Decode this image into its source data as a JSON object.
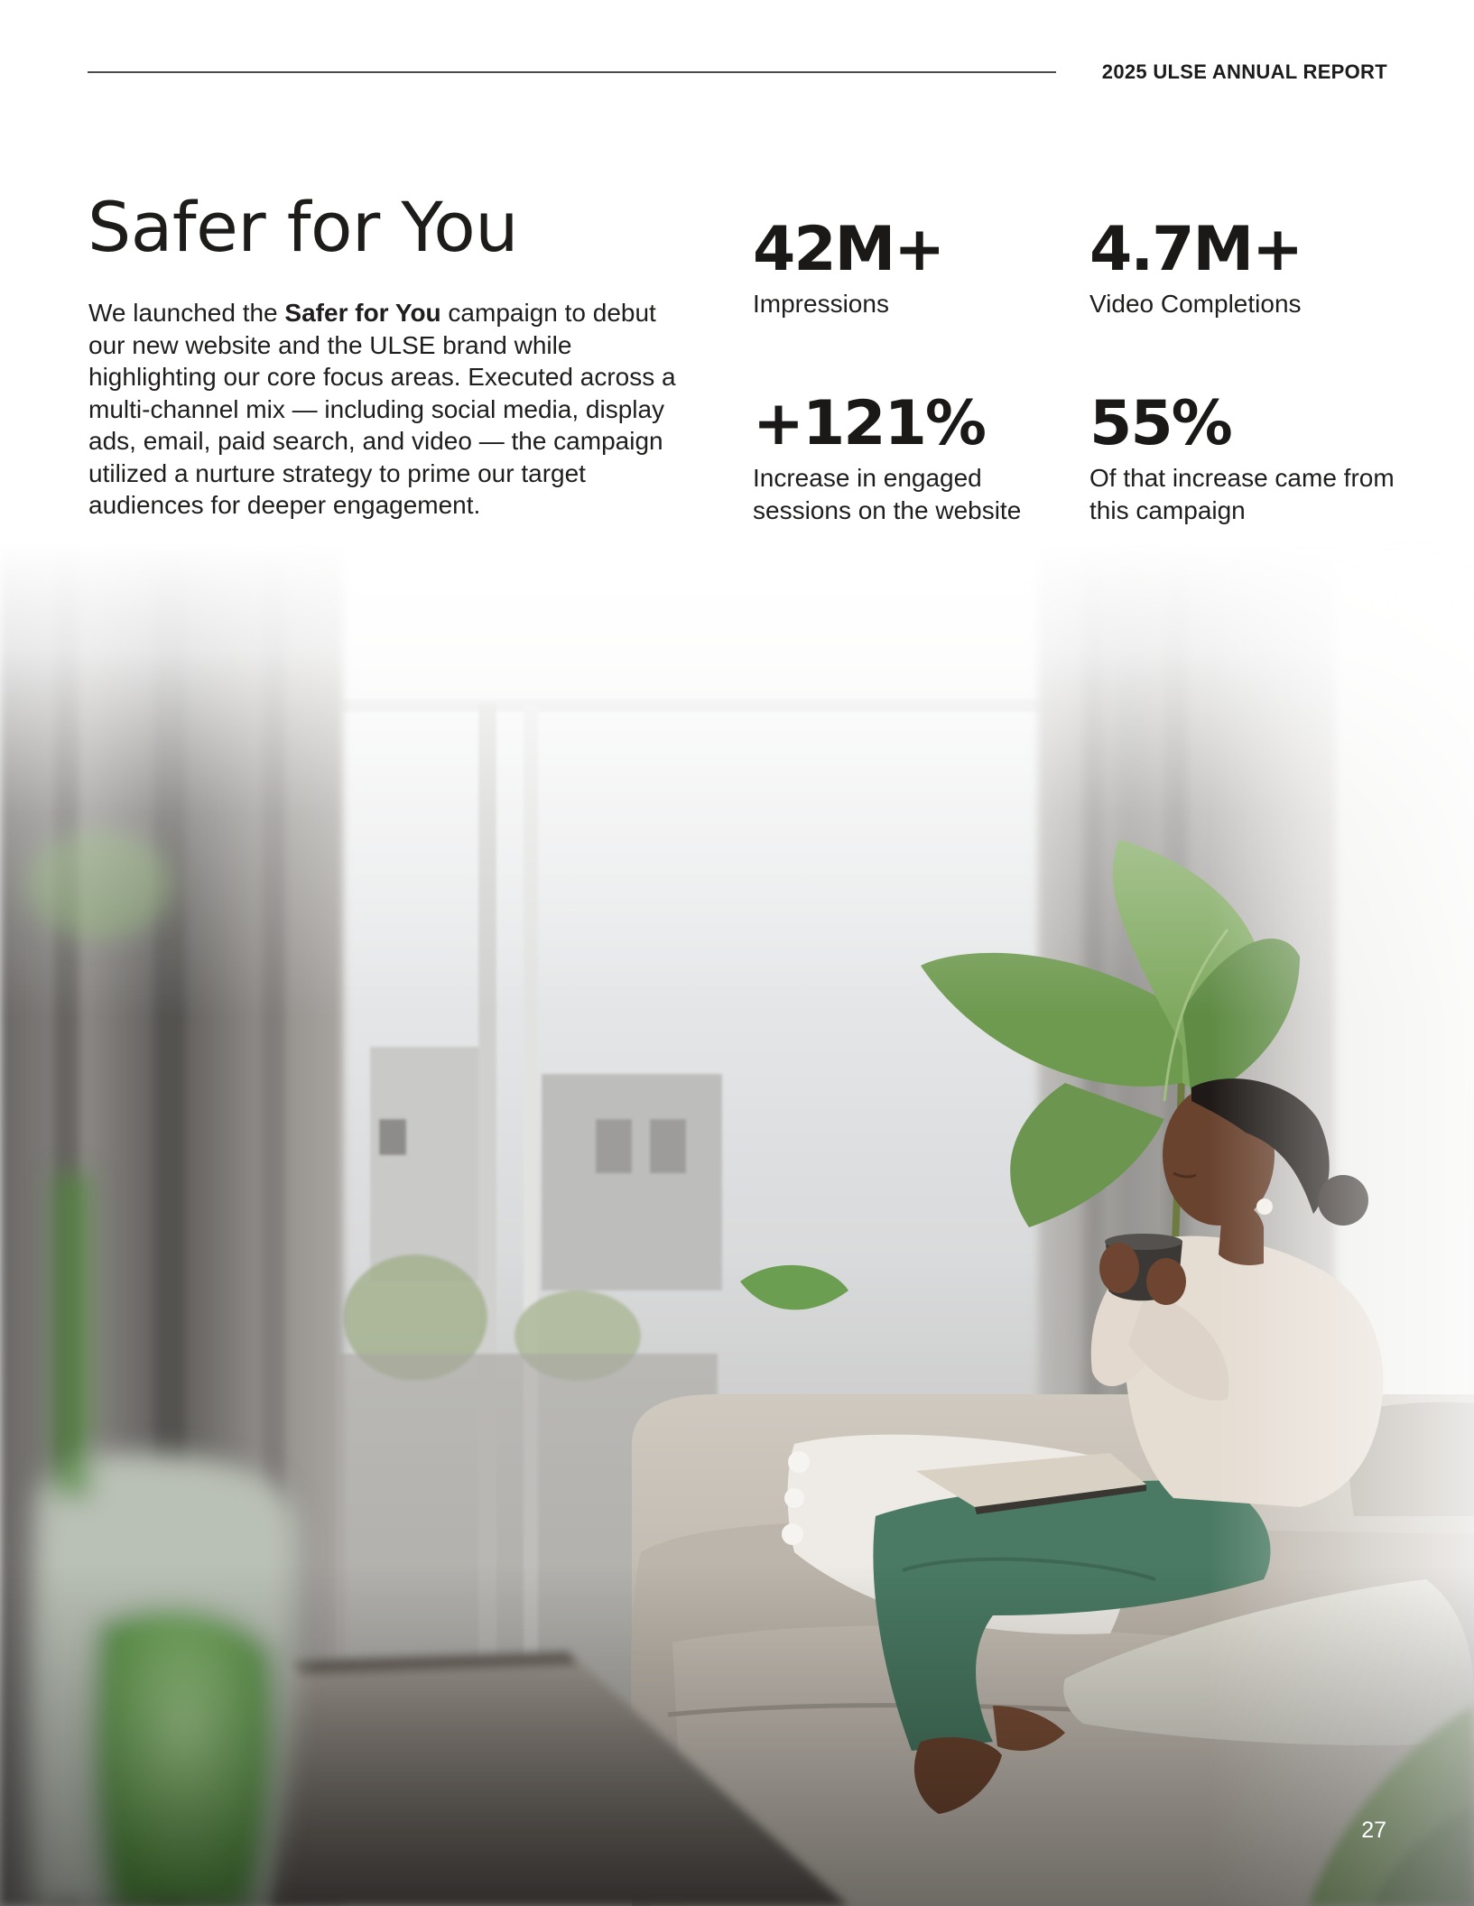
{
  "header": {
    "report_label": "2025 ULSE ANNUAL REPORT"
  },
  "article": {
    "title": "Safer for You",
    "intro_before": "We launched the ",
    "intro_bold": "Safer for You",
    "intro_after": " campaign to debut our new website and the ULSE brand while highlighting our core focus areas. Executed across a multi-channel mix — including social media, display ads, email, paid search, and video — the campaign utilized a nurture strategy to prime our target audiences for deeper engagement."
  },
  "stats": [
    {
      "value": "42M+",
      "label": "Impressions"
    },
    {
      "value": "4.7M+",
      "label": "Video Completions"
    },
    {
      "value": "+121%",
      "label": "Increase in engaged sessions on the website"
    },
    {
      "value": "55%",
      "label": "Of that increase came from this campaign"
    }
  ],
  "photo": {
    "icon": "lifestyle-photo-woman-on-sofa"
  },
  "footer": {
    "page_number": "27"
  },
  "colors": {
    "text": "#1e1d1c",
    "rule": "#4b4b4b",
    "pants_green": "#4a7a63",
    "plant_green": "#5d8a45",
    "sofa": "#c9c3ba"
  }
}
